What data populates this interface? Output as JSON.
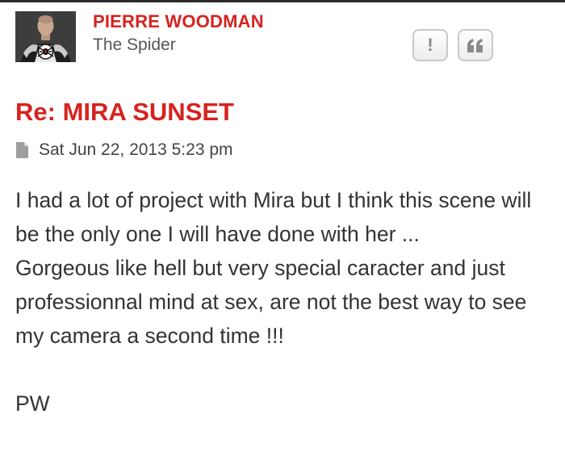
{
  "author": {
    "name": "PIERRE WOODMAN",
    "rank": "The Spider",
    "avatar_icon": "spider-emblem-avatar"
  },
  "actions": {
    "report": {
      "label": "!",
      "icon": "report-icon"
    },
    "quote": {
      "icon": "quote-icon"
    }
  },
  "post": {
    "title": "Re: MIRA SUNSET",
    "date_icon": "document-icon",
    "date": "Sat Jun 22, 2013 5:23 pm",
    "paragraphs": [
      "I had a lot of project with Mira but I think this scene will be the only one I will have done with her ...",
      "Gorgeous like hell but very special caracter and just professionnal mind at sex, are not the best way to see my camera a second time !!!"
    ],
    "signature": "PW"
  },
  "colors": {
    "accent": "#d6231f",
    "text": "#333333",
    "button_border": "#c9c9c9",
    "button_icon": "#8a8a8a"
  }
}
